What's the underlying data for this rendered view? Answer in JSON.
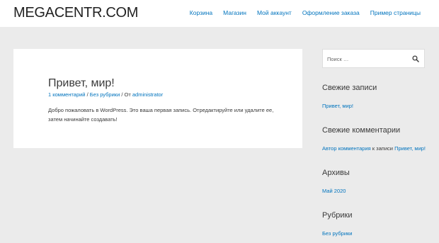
{
  "header": {
    "site_title": "MEGACENTR.COM",
    "nav": [
      "Корзина",
      "Магазин",
      "Мой аккаунт",
      "Оформление заказа",
      "Пример страницы"
    ]
  },
  "post": {
    "title": "Привет, мир!",
    "meta": {
      "comments": "1 комментарий",
      "sep1": " / ",
      "category": "Без рубрики",
      "sep2": " / От ",
      "author": "administrator"
    },
    "body": "Добро пожаловать в WordPress. Это ваша первая запись. Отредактируйте или удалите ее, затем начинайте создавать!"
  },
  "sidebar": {
    "search": {
      "placeholder": "Поиск …"
    },
    "recent_posts": {
      "title": "Свежие записи",
      "items": [
        "Привет, мир!"
      ]
    },
    "recent_comments": {
      "title": "Свежие комментарии",
      "author": "Автор комментария",
      "on": " к записи ",
      "post": "Привет, мир!"
    },
    "archives": {
      "title": "Архивы",
      "items": [
        "Май 2020"
      ]
    },
    "categories": {
      "title": "Рубрики",
      "items": [
        "Без рубрики"
      ]
    }
  }
}
